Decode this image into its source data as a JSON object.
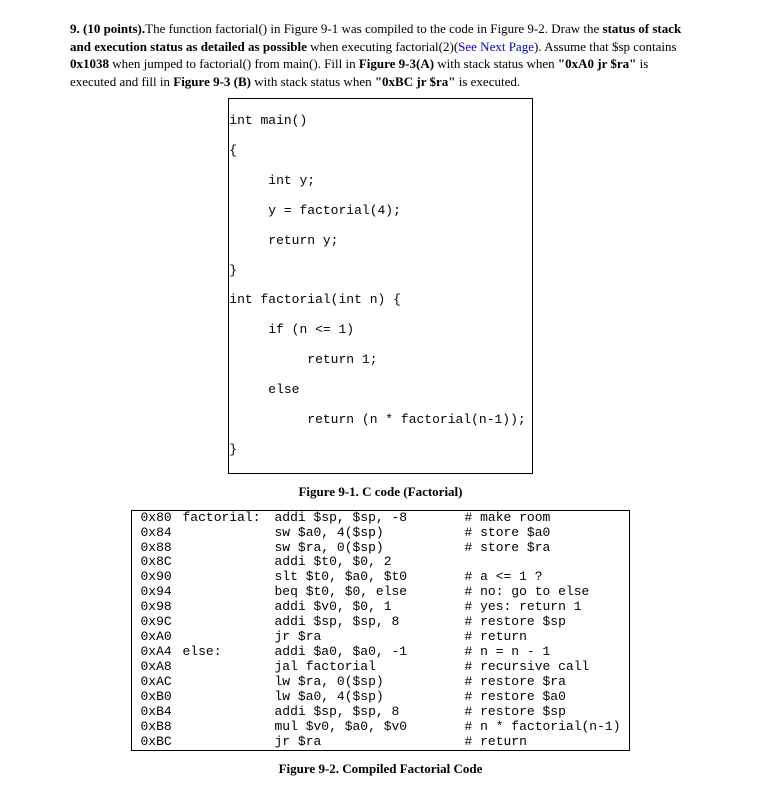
{
  "question": {
    "number": "9. (10 points).",
    "text1": "The function factorial() in Figure 9-1 was compiled to the code in Figure 9-2. Draw the ",
    "bold1": "status of stack and execution status as detailed as possible",
    "text2": " when executing factorial(2)(",
    "blue1": "See Next Page",
    "text3": "). Assume that $sp contains ",
    "bold2": "0x1038",
    "text4": " when jumped to factorial() from main(). Fill in ",
    "bold3": "Figure 9-3(A)",
    "text5": " with stack status when ",
    "bold4": "\"0xA0 jr $ra\"",
    "text6": " is executed and fill in ",
    "bold5": "Figure 9-3 (B)",
    "text7": " with stack status when ",
    "bold6": "\"0xBC jr $ra\"",
    "text8": " is executed."
  },
  "code1": {
    "l1": "int main()",
    "l2": "{",
    "l3": "     int y;",
    "l4": "     y = factorial(4);",
    "l5": "     return y;",
    "l6": "}",
    "l7": "int factorial(int n) {",
    "l8": "     if (n <= 1)",
    "l9": "          return 1;",
    "l10": "     else",
    "l11": "          return (n * factorial(n-1));",
    "l12": "}"
  },
  "fig1_caption": "Figure 9-1. C code (Factorial)",
  "code2": [
    {
      "a": "0x80",
      "lbl": "factorial:",
      "ins": "addi $sp, $sp, -8",
      "c": "# make room"
    },
    {
      "a": "0x84",
      "lbl": "",
      "ins": "sw $a0, 4($sp)",
      "c": "# store $a0"
    },
    {
      "a": "0x88",
      "lbl": "",
      "ins": "sw $ra, 0($sp)",
      "c": "# store $ra"
    },
    {
      "a": "0x8C",
      "lbl": "",
      "ins": "addi $t0, $0, 2",
      "c": ""
    },
    {
      "a": "0x90",
      "lbl": "",
      "ins": "slt $t0, $a0, $t0",
      "c": "# a <= 1 ?"
    },
    {
      "a": "0x94",
      "lbl": "",
      "ins": "beq $t0, $0, else",
      "c": "# no: go to else"
    },
    {
      "a": "0x98",
      "lbl": "",
      "ins": "addi $v0, $0, 1",
      "c": "# yes: return 1"
    },
    {
      "a": "0x9C",
      "lbl": "",
      "ins": "addi $sp, $sp, 8",
      "c": "# restore $sp"
    },
    {
      "a": "0xA0",
      "lbl": "",
      "ins": "jr $ra",
      "c": "# return"
    },
    {
      "a": "0xA4",
      "lbl": "else:",
      "ins": "addi $a0, $a0, -1",
      "c": "# n = n - 1"
    },
    {
      "a": "0xA8",
      "lbl": "",
      "ins": "jal factorial",
      "c": "# recursive call"
    },
    {
      "a": "0xAC",
      "lbl": "",
      "ins": "lw $ra, 0($sp)",
      "c": "# restore $ra"
    },
    {
      "a": "0xB0",
      "lbl": "",
      "ins": "lw $a0, 4($sp)",
      "c": "# restore $a0"
    },
    {
      "a": "0xB4",
      "lbl": "",
      "ins": "addi $sp, $sp, 8",
      "c": "# restore $sp"
    },
    {
      "a": "0xB8",
      "lbl": "",
      "ins": "mul $v0, $a0, $v0",
      "c": "# n * factorial(n-1)"
    },
    {
      "a": "0xBC",
      "lbl": "",
      "ins": "jr $ra",
      "c": "# return"
    }
  ],
  "fig2_caption": "Figure 9-2. Compiled Factorial Code"
}
